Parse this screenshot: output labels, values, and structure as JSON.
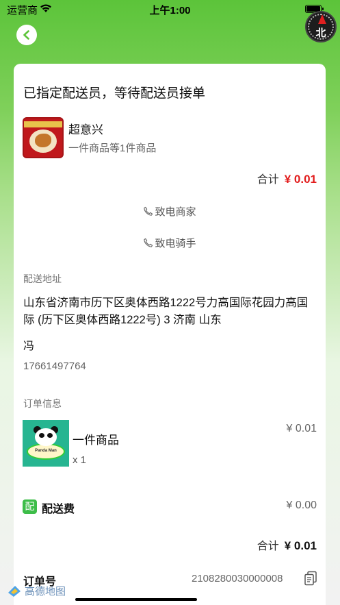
{
  "status_bar": {
    "carrier": "运营商",
    "time": "上午1:00",
    "battery_level": 1.0
  },
  "compass": {
    "label": "北"
  },
  "order": {
    "status_title": "已指定配送员，等待配送员接单",
    "shop_name": "超意兴",
    "shop_summary": "一件商品等1件商品",
    "total_label": "合计",
    "total_value": "¥ 0.01",
    "call_merchant": "致电商家",
    "call_rider": "致电骑手"
  },
  "delivery": {
    "section_label": "配送地址",
    "address": "山东省济南市历下区奥体西路1222号力高国际花园力高国际 (历下区奥体西路1222号) 3 济南 山东",
    "recipient": "冯",
    "phone": "17661497764"
  },
  "order_info": {
    "section_label": "订单信息",
    "item_image_label": "Panda Man",
    "item_name": "一件商品",
    "item_qty": "x 1",
    "item_price": "¥ 0.01",
    "fee_icon": "配",
    "fee_label": "配送费",
    "fee_value": "¥ 0.00",
    "total_label": "合计",
    "total_value": "¥ 0.01",
    "order_no_label": "订单号",
    "order_no_value": "2108280030000008"
  },
  "map_logo": {
    "text": "高德地图"
  },
  "colors": {
    "accent_green": "#5cc43a",
    "price_red": "#e21b1b"
  }
}
